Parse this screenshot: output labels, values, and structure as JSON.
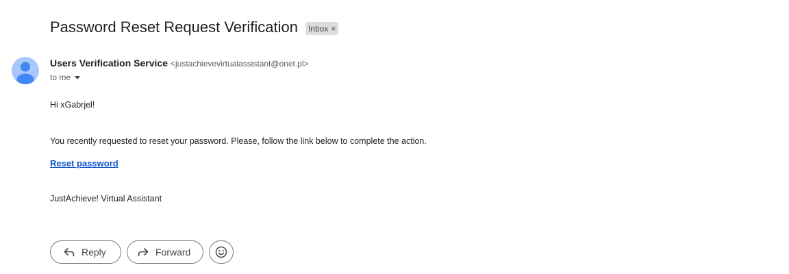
{
  "email": {
    "subject": "Password Reset Request Verification",
    "label": "Inbox",
    "label_remove_icon": "×",
    "sender_name": "Users Verification Service",
    "sender_email": "<justachievevirtualassistant@onet.pl>",
    "recipient": "to me",
    "greeting": "Hi xGabrjel!",
    "message": "You recently requested to reset your password. Please, follow the link below to complete the action.",
    "link_text": "Reset password",
    "signature": "JustAchieve! Virtual Assistant"
  },
  "actions": {
    "reply_label": "Reply",
    "forward_label": "Forward"
  },
  "icons": {
    "avatar": "person-avatar-icon",
    "recipient_dropdown": "caret-down-icon",
    "reply": "reply-arrow-icon",
    "forward": "forward-arrow-icon",
    "emoji": "smiley-icon"
  },
  "colors": {
    "avatar_bg": "#a8c7fa",
    "avatar_figure": "#4285f4",
    "link": "#1155cc",
    "chip_bg": "#dddddd"
  }
}
